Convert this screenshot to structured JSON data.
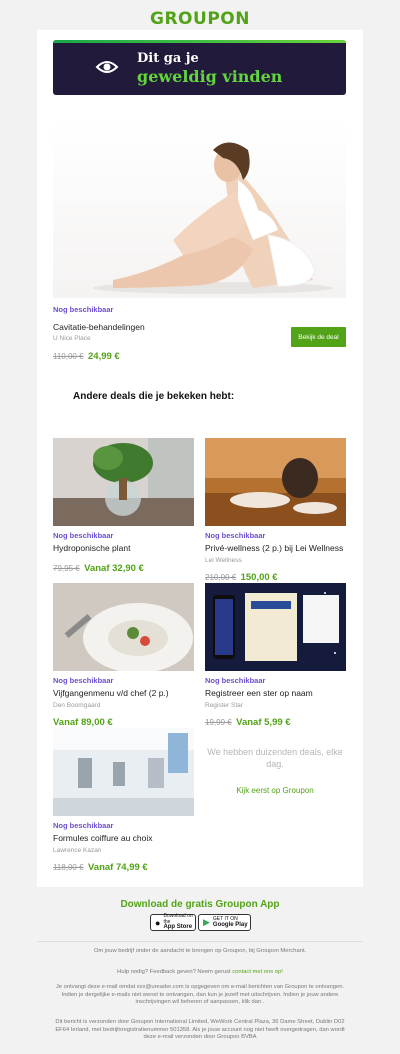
{
  "header": {
    "logo": "GROUPON"
  },
  "banner": {
    "line1": "Dit ga je",
    "line2": "geweldig vinden"
  },
  "featured": {
    "availability": "Nog beschikbaar",
    "title": "Cavitatie-behandelingen",
    "merchant": "U Nice Place",
    "old_price": "110,00 €",
    "new_price": "24,99 €",
    "cta": "Bekijk de deal"
  },
  "section_title": "Andere deals die je bekeken hebt:",
  "deals": [
    {
      "availability": "Nog beschikbaar",
      "title": "Hydroponische plant",
      "merchant": "",
      "old_price": "79,95 €",
      "new_price": "Vanaf 32,90 €"
    },
    {
      "availability": "Nog beschikbaar",
      "title": "Privé-wellness (2 p.) bij Lei Wellness",
      "merchant": "Lei Wellness",
      "old_price": "210,00 €",
      "new_price": "150,00 €"
    },
    {
      "availability": "Nog beschikbaar",
      "title": "Vijfgangenmenu v/d chef (2 p.)",
      "merchant": "Den Boomgaard",
      "old_price": "",
      "new_price": "Vanaf 89,00 €"
    },
    {
      "availability": "Nog beschikbaar",
      "title": "Registreer een ster op naam",
      "merchant": "Register Star",
      "old_price": "19,99 €",
      "new_price": "Vanaf 5,99 €"
    },
    {
      "availability": "Nog beschikbaar",
      "title": "Formules coiffure au choix",
      "merchant": "Lawrence Kazan",
      "old_price": "118,00 €",
      "new_price": "Vanaf 74,99 €"
    }
  ],
  "empty_slot": {
    "message": "We hebben duizenden deals, elke dag.",
    "link": "Kijk eerst op Groupon"
  },
  "app": {
    "title": "Download de gratis Groupon App",
    "appstore_small": "Download on the",
    "appstore_big": "App Store",
    "play_small": "GET IT ON",
    "play_big": "Google Play"
  },
  "footer": {
    "merchant_line": "Om jouw bedrijf onder de aandacht te brengen op Groupon, bij Groupon Merchant.",
    "help_prefix": "Hulp nodig? Feedback geven? Neem gerust",
    "help_link": "contact met ons op!",
    "subscription": "Je ontvangt deze e-mail omdat xxx@ureader.com is opgegeven om e-mail berichten van Groupon te ontvangen. Indien je dergelijke e-mails niet wenst te ontvangen, dan kun je jezelf met uitschrijven. Indien je jouw andere inschrijvingen wil beheren of aanpassen, klik dan .",
    "legal": "Dit bericht is verzonden door Groupon International Limited, WeWork Central Plaza, 36 Dame Street, Dublin D02 EF64 Ierland, met bedrijfsregistratienummer 501358. Als je jouw account nog niet heeft overgedragen, dan wordt deze e-mail verzonden door Groupon BVBA"
  },
  "colors": {
    "brand_green": "#53a318",
    "availability_purple": "#6c4ed4",
    "banner_bg": "#221a3a"
  }
}
